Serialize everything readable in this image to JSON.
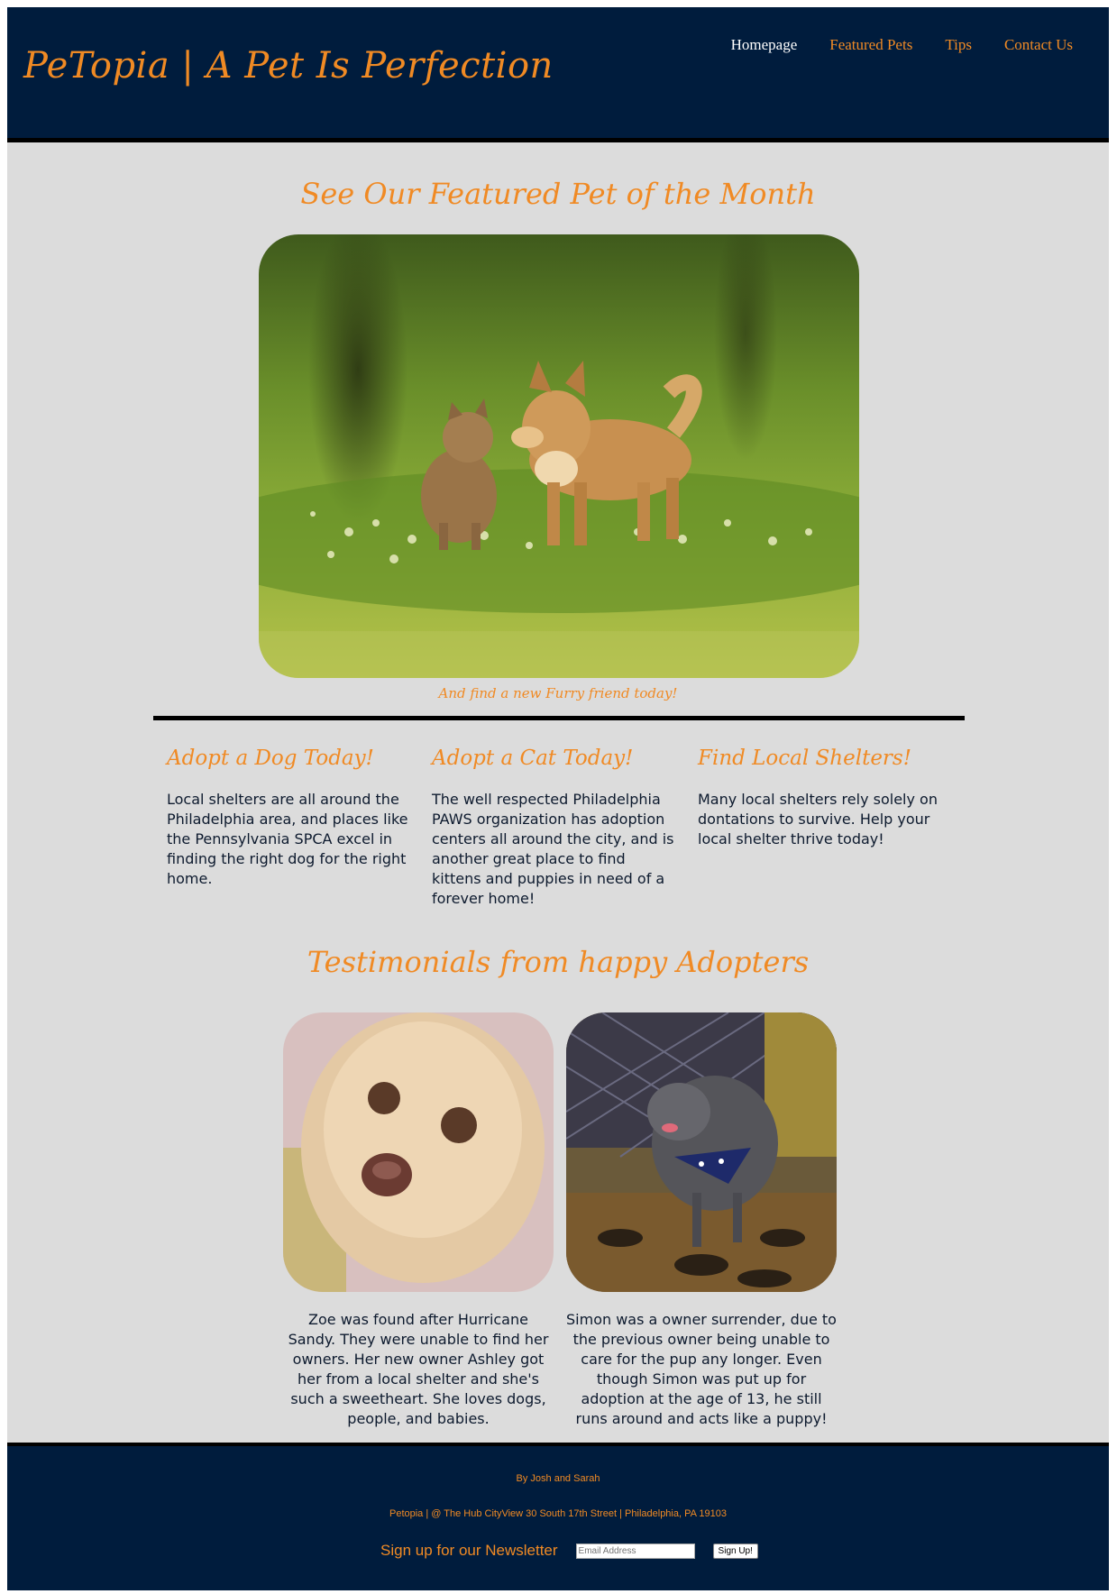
{
  "header": {
    "title": "PeTopia | A Pet Is Perfection",
    "nav": [
      "Homepage",
      "Featured Pets",
      "Tips",
      "Contact Us"
    ]
  },
  "featured": {
    "heading": "See Our Featured Pet of the Month",
    "caption": "And find a new Furry friend today!"
  },
  "columns": [
    {
      "title": "Adopt a Dog Today!",
      "body": "Local shelters are all around the Philadelphia area, and places like the Pennsylvania SPCA excel in finding the right dog for the right home."
    },
    {
      "title": "Adopt a Cat Today!",
      "body": "The well respected Philadelphia PAWS organization has adoption centers all around the city, and is another great place to find kittens and puppies in need of a forever home!"
    },
    {
      "title": "Find Local Shelters!",
      "body": "Many local shelters rely solely on dontations to survive. Help your local shelter thrive today!"
    }
  ],
  "testimonials": {
    "heading": "Testimonials from happy Adopters",
    "items": [
      {
        "text": "Zoe was found after Hurricane Sandy. They were unable to find her owners. Her new owner Ashley got her from a local shelter and she's such a sweetheart. She loves dogs, people, and babies."
      },
      {
        "text": "Simon was a owner surrender, due to the previous owner being unable to care for the pup any longer. Even though Simon was put up for adoption at the age of 13, he still runs around and acts like a puppy!"
      }
    ]
  },
  "footer": {
    "credit": "By Josh and Sarah",
    "address": "Petopia | @ The Hub CityView 30 South 17th Street | Philadelphia, PA 19103",
    "newsletter_label": "Sign up for our Newsletter",
    "email_placeholder": "Email Address",
    "signup_label": "Sign Up!"
  },
  "colors": {
    "navy": "#001c3d",
    "accent": "#f08a24",
    "page": "#dcdcdc"
  }
}
